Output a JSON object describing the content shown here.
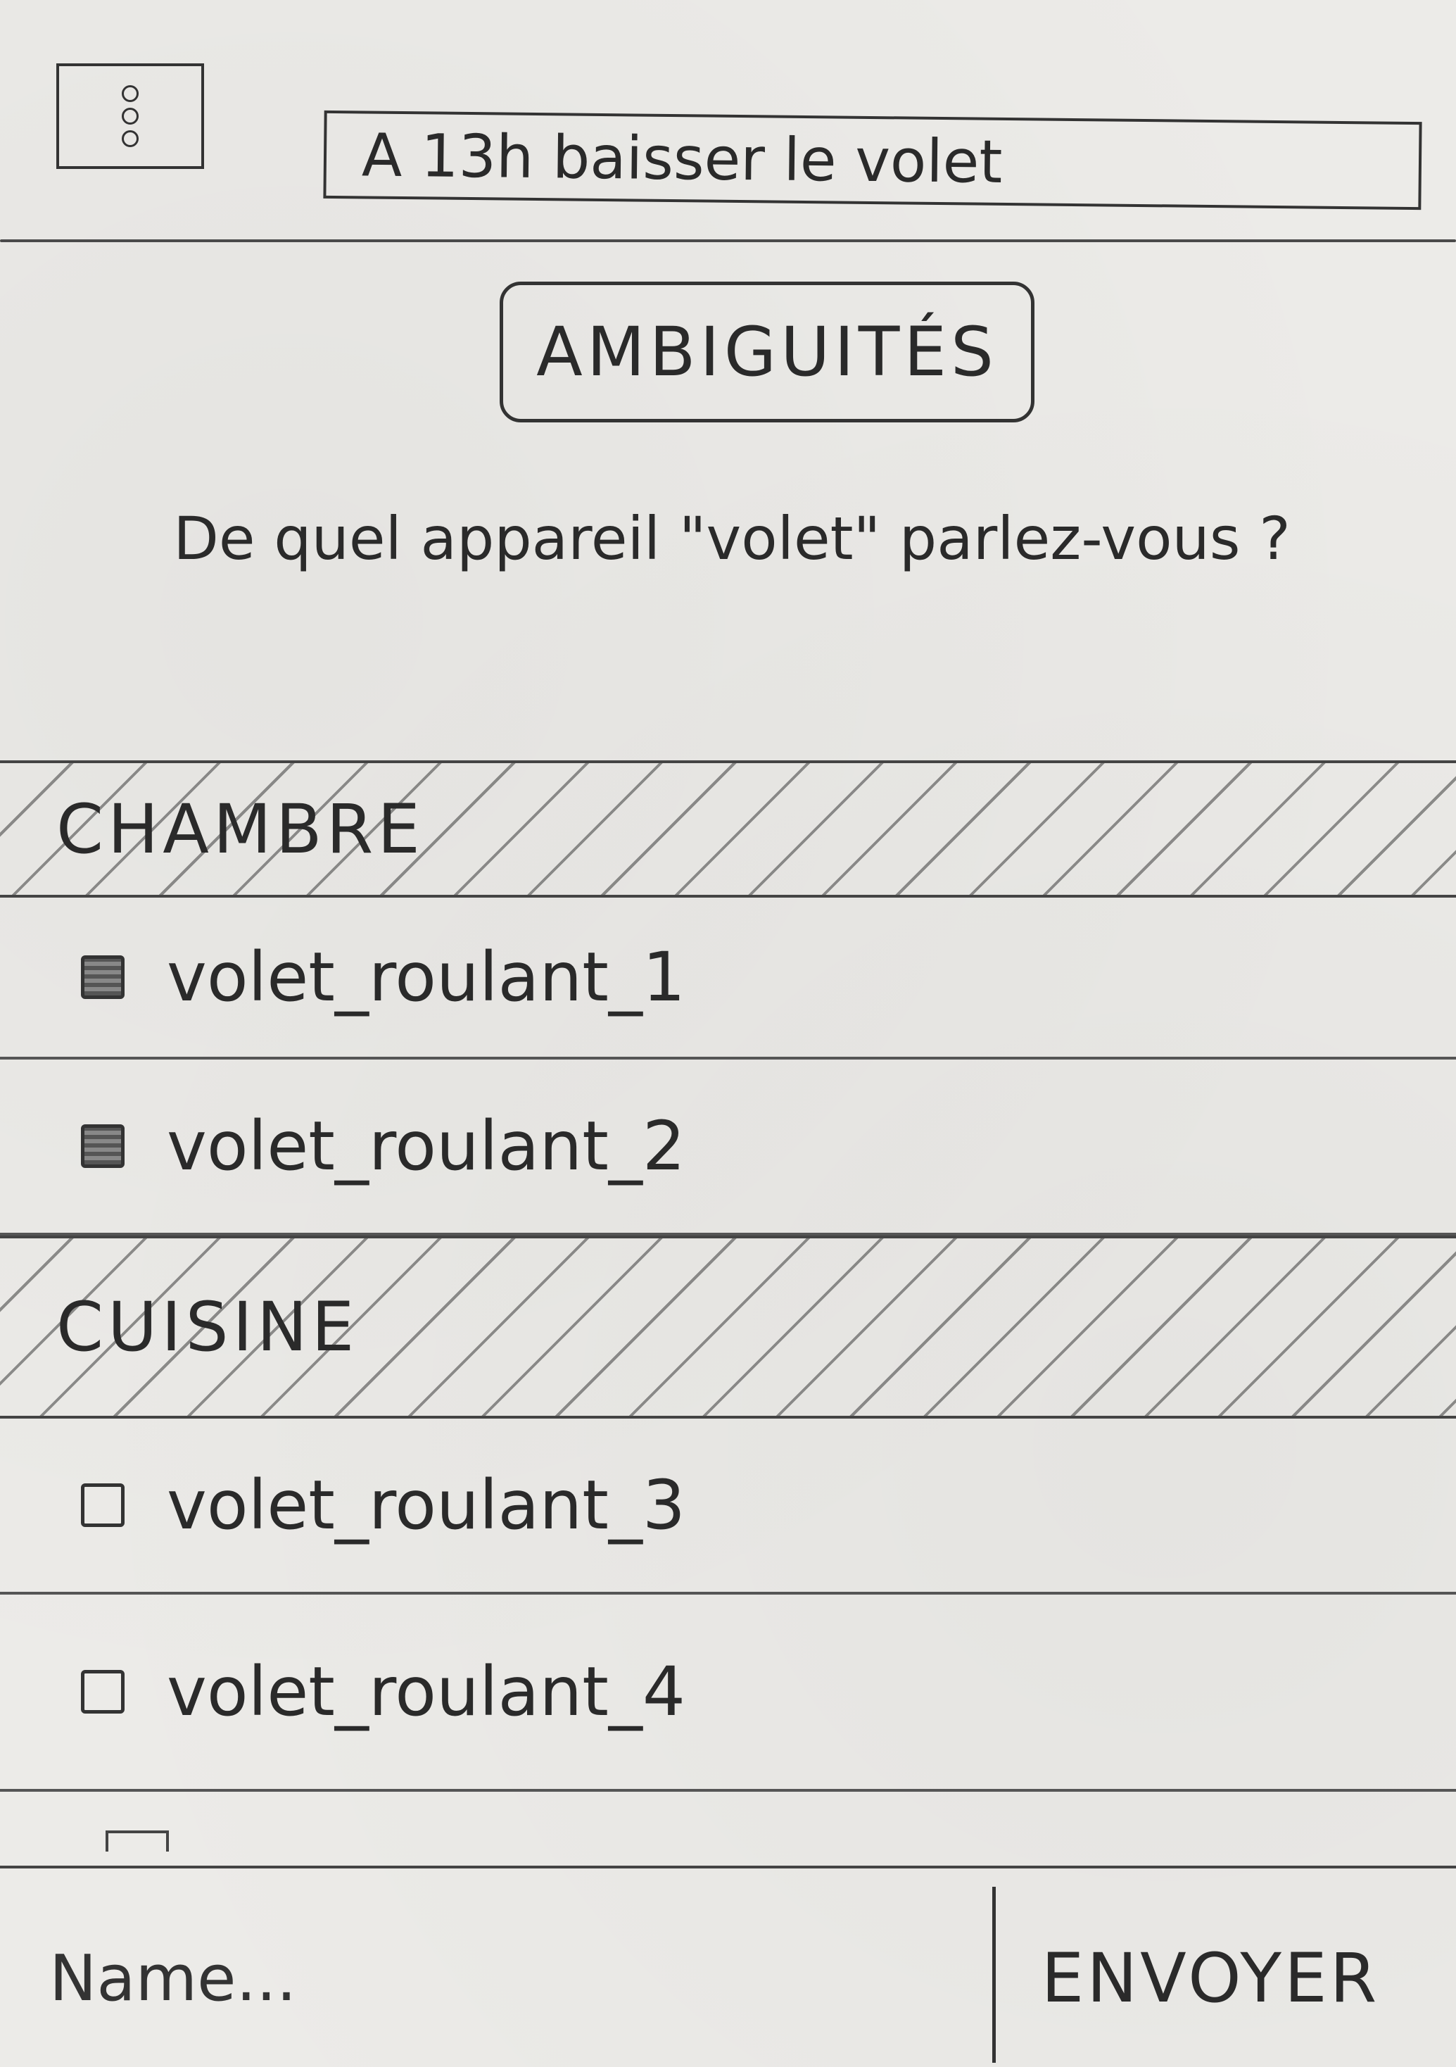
{
  "header": {
    "menu_icon": "vertical-dots-icon",
    "command_text": "A 13h baisser le volet"
  },
  "ambiguity": {
    "title": "AMBIGUITÉS",
    "question": "De quel appareil \"volet\" parlez-vous ?"
  },
  "groups": [
    {
      "name": "CHAMBRE",
      "devices": [
        {
          "label": "volet_roulant_1",
          "checked": true
        },
        {
          "label": "volet_roulant_2",
          "checked": true
        }
      ]
    },
    {
      "name": "CUISINE",
      "devices": [
        {
          "label": "volet_roulant_3",
          "checked": false
        },
        {
          "label": "volet_roulant_4",
          "checked": false
        }
      ]
    }
  ],
  "composer": {
    "placeholder": "Name...",
    "send_label": "ENVOYER"
  }
}
